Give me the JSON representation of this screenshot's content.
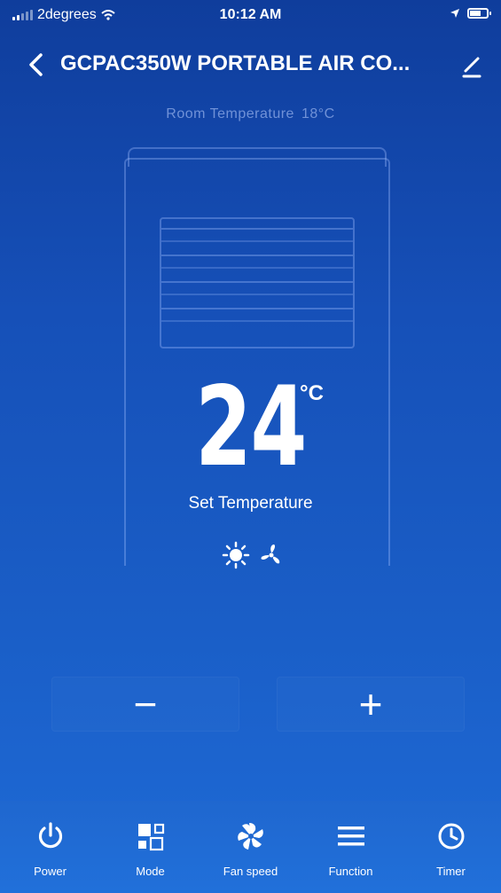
{
  "status_bar": {
    "carrier": "2degrees",
    "time": "10:12 AM"
  },
  "header": {
    "title": "GCPAC350W PORTABLE AIR CO...",
    "back_icon": "chevron-left-icon",
    "edit_icon": "pencil-icon"
  },
  "room_temperature": {
    "label": "Room Temperature",
    "value": "18°C"
  },
  "set_temperature": {
    "value": "24",
    "unit": "°C",
    "label": "Set Temperature"
  },
  "mode_icons": [
    "sun-icon",
    "fan-icon"
  ],
  "controls": {
    "decrease_label": "−",
    "increase_label": "+"
  },
  "bottom_nav": [
    {
      "label": "Power",
      "icon": "power-icon"
    },
    {
      "label": "Mode",
      "icon": "mode-icon"
    },
    {
      "label": "Fan speed",
      "icon": "fan-speed-icon"
    },
    {
      "label": "Function",
      "icon": "menu-icon"
    },
    {
      "label": "Timer",
      "icon": "clock-icon"
    }
  ],
  "colors": {
    "background_top": "#0f3d9c",
    "background_bottom": "#1e6ad6",
    "nav_background": "#1f67cf",
    "text": "#ffffff",
    "muted_text": "#9eb6ee"
  }
}
